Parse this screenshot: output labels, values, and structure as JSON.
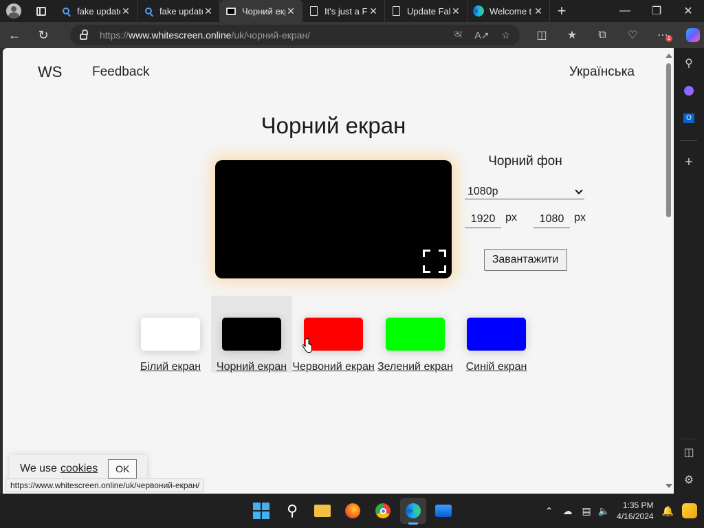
{
  "browser": {
    "tabs": [
      {
        "label": "fake update",
        "icon": "search-icon",
        "active": false
      },
      {
        "label": "fake update",
        "icon": "search-icon",
        "active": false
      },
      {
        "label": "Чорний екран",
        "icon": "monitor-icon",
        "active": true
      },
      {
        "label": "It's just a F",
        "icon": "document-icon",
        "active": false
      },
      {
        "label": "Update Fak",
        "icon": "document-icon",
        "active": false
      },
      {
        "label": "Welcome t",
        "icon": "edge-icon",
        "active": false
      }
    ],
    "tab_close": "✕",
    "new_tab": "+",
    "url_prefix": "https://",
    "url_host": "www.whitescreen.online",
    "url_path": "/uk/чорний-екран/",
    "extension_badge": "1"
  },
  "page": {
    "logo": "WS",
    "feedback": "Feedback",
    "language": "Українська",
    "title": "Чорний екран",
    "preview_color": "#000000",
    "settings": {
      "heading": "Чорний фон",
      "resolution": "1080p",
      "width": "1920",
      "height": "1080",
      "unit": "px",
      "download": "Завантажити"
    },
    "swatches": [
      {
        "label": "Білий екран",
        "color": "#ffffff"
      },
      {
        "label": "Чорний екран",
        "color": "#000000"
      },
      {
        "label": "Червоний екран",
        "color": "#ff0000"
      },
      {
        "label": "Зелений екран",
        "color": "#00ff00"
      },
      {
        "label": "Синій екран",
        "color": "#0000ff"
      }
    ],
    "cookie": {
      "text": "We use",
      "link": "cookies",
      "ok": "OK"
    },
    "status_url": "https://www.whitescreen.online/uk/червоний-екран/"
  },
  "taskbar": {
    "time": "1:35 PM",
    "date": "4/16/2024",
    "accent": "#46b0f0"
  }
}
